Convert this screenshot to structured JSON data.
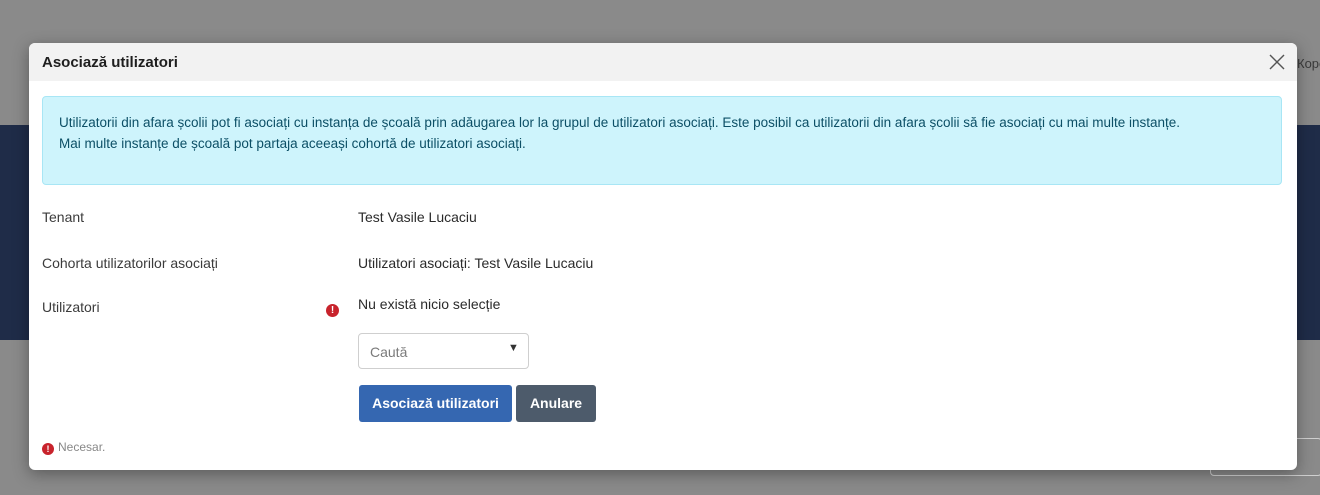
{
  "background": {
    "edge_text": "Кope"
  },
  "modal": {
    "title": "Asociază utilizatori",
    "close_icon": "close-icon",
    "info_text_line1": "Utilizatorii din afara școlii pot fi asociați cu instanța de școală prin adăugarea lor la grupul de utilizatori asociați. Este posibil ca utilizatorii din afara școlii să fie asociați cu mai multe instanțe.",
    "info_text_line2": "Mai multe instanțe de școală pot partaja aceeași cohortă de utilizatori asociați.",
    "fields": {
      "tenant_label": "Tenant",
      "tenant_value": "Test Vasile Lucaciu",
      "cohort_label": "Cohorta utilizatorilor asociați",
      "cohort_value": "Utilizatori asociați: Test Vasile Lucaciu",
      "users_label": "Utilizatori",
      "users_required_icon": "!",
      "users_value": "Nu există nicio selecție",
      "search_placeholder": "Caută"
    },
    "buttons": {
      "associate": "Asociază utilizatori",
      "cancel": "Anulare"
    },
    "footer": {
      "required_icon": "!",
      "required_text": "Necesar."
    }
  },
  "colors": {
    "primary": "#3567b1",
    "secondary": "#4d5b6b",
    "required": "#c8232c",
    "info_bg": "#cef4fc"
  }
}
